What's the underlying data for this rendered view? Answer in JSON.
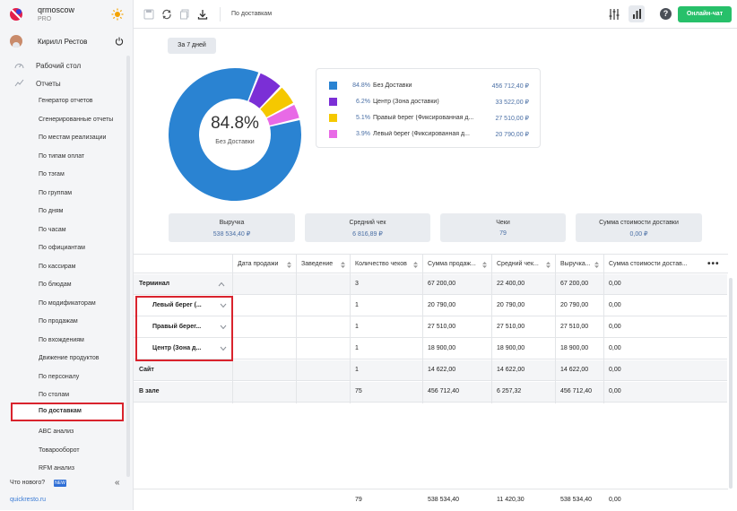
{
  "brand": {
    "name": "qrmoscow",
    "plan": "PRO"
  },
  "user": {
    "name": "Кирилл Рестов"
  },
  "nav": {
    "dashboard": "Рабочий стол",
    "reports": "Отчеты",
    "items": [
      "Генератор отчетов",
      "Сгенерированные отчеты",
      "По местам реализации",
      "По типам оплат",
      "По тэгам",
      "По группам",
      "По дням",
      "По часам",
      "По официантам",
      "По кассирам",
      "По блюдам",
      "По модификаторам",
      "По продажам",
      "По вхождениям",
      "Движение продуктов",
      "По персоналу",
      "По столам",
      "По доставкам",
      "ABC анализ",
      "Товарооборот",
      "RFM анализ"
    ],
    "active_index": 17,
    "whats_new": "Что нового?",
    "new_badge": "NEW",
    "site_link": "quickresto.ru"
  },
  "topbar": {
    "title": "По доставкам",
    "chat_button": "Онлайн-чат",
    "help": "?"
  },
  "period": "За 7 дней",
  "donut": {
    "center_pct": "84.8%",
    "center_label": "Без Доставки"
  },
  "chart_data": {
    "type": "pie",
    "slices": [
      {
        "name": "Без Доставки",
        "pct": 84.8,
        "value": "456 712,40 ₽",
        "color": "#2a83d2"
      },
      {
        "name": "Центр (Зона доставки)",
        "pct": 6.2,
        "value": "33 522,00 ₽",
        "color": "#7b2fd6"
      },
      {
        "name": "Правый берег (Фиксированная доставка)",
        "pct": 5.1,
        "value": "27 510,00 ₽",
        "color": "#f5c800"
      },
      {
        "name": "Левый берег (Фиксированная доставка)",
        "pct": 3.9,
        "value": "20 790,00 ₽",
        "color": "#e86ae6"
      }
    ]
  },
  "legend": [
    {
      "pct": "84.8%",
      "name": "Без Доставки",
      "value": "456 712,40 ₽"
    },
    {
      "pct": "6.2%",
      "name": "Центр (Зона доставки)",
      "value": "33 522,00 ₽"
    },
    {
      "pct": "5.1%",
      "name": "Правый берег (Фиксированная д...",
      "value": "27 510,00 ₽"
    },
    {
      "pct": "3.9%",
      "name": "Левый берег (Фиксированная д...",
      "value": "20 790,00 ₽"
    }
  ],
  "kpis": [
    {
      "title": "Выручка",
      "value": "538 534,40 ₽"
    },
    {
      "title": "Средний чек",
      "value": "6 816,89 ₽"
    },
    {
      "title": "Чеки",
      "value": "79"
    },
    {
      "title": "Сумма стоимости доставки",
      "value": "0,00 ₽"
    }
  ],
  "table": {
    "headers": [
      "Дата продажи",
      "Заведение",
      "Количество чеков",
      "Сумма продаж...",
      "Средний чек...",
      "Выручка...",
      "Сумма стоимости достав..."
    ],
    "rows": [
      {
        "type": "group",
        "name": "Терминал",
        "cells": [
          "3",
          "67 200,00",
          "22 400,00",
          "67 200,00",
          "0,00"
        ]
      },
      {
        "type": "child",
        "name": "Левый берег (...",
        "cells": [
          "1",
          "20 790,00",
          "20 790,00",
          "20 790,00",
          "0,00"
        ]
      },
      {
        "type": "child",
        "name": "Правый берег...",
        "cells": [
          "1",
          "27 510,00",
          "27 510,00",
          "27 510,00",
          "0,00"
        ]
      },
      {
        "type": "child",
        "name": "Центр (Зона д...",
        "cells": [
          "1",
          "18 900,00",
          "18 900,00",
          "18 900,00",
          "0,00"
        ]
      },
      {
        "type": "group",
        "name": "Сайт",
        "cells": [
          "1",
          "14 622,00",
          "14 622,00",
          "14 622,00",
          "0,00"
        ]
      },
      {
        "type": "group",
        "name": "В зале",
        "cells": [
          "75",
          "456 712,40",
          "6 257,32",
          "456 712,40",
          "0,00"
        ]
      }
    ],
    "footer": [
      "79",
      "538 534,40",
      "11 420,30",
      "538 534,40",
      "0,00"
    ]
  }
}
